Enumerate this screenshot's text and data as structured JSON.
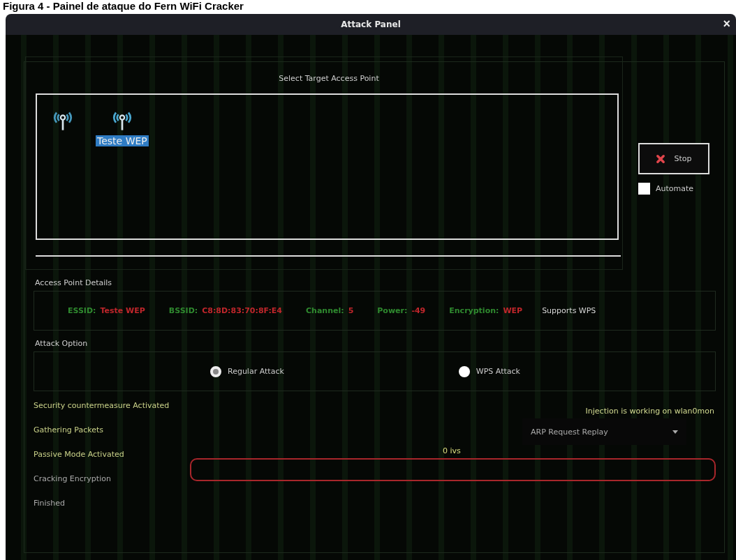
{
  "caption": "Figura 4 - Painel de ataque do Fern WiFi Cracker",
  "window": {
    "title": "Attack Panel",
    "close": "×"
  },
  "target": {
    "heading": "Select Target Access Point",
    "access_points": [
      {
        "selected": false
      },
      {
        "label": "Teste WEP",
        "selected": true
      }
    ]
  },
  "stop_button": {
    "label": "Stop"
  },
  "automate": {
    "label": "Automate",
    "checked": false
  },
  "details": {
    "heading": "Access Point Details",
    "fields": [
      {
        "label": "ESSID:",
        "value": "Teste WEP"
      },
      {
        "label": "BSSID:",
        "value": "C8:8D:83:70:8F:E4"
      },
      {
        "label": "Channel:",
        "value": "5"
      },
      {
        "label": "Power:",
        "value": "-49"
      },
      {
        "label": "Encryption:",
        "value": "WEP"
      }
    ],
    "wps_note": "Supports WPS"
  },
  "attack_option": {
    "heading": "Attack Option",
    "options": [
      {
        "label": "Regular Attack",
        "selected": true
      },
      {
        "label": "WPS  Attack",
        "selected": false
      }
    ]
  },
  "steps": [
    {
      "label": "Security countermeasure Activated",
      "active": true
    },
    {
      "label": "Gathering Packets",
      "active": true
    },
    {
      "label": "Passive Mode Activated",
      "active": true
    },
    {
      "label": "Cracking Encryption",
      "active": false
    },
    {
      "label": "Finished",
      "active": false
    }
  ],
  "injection_status": "Injection is working on wlan0mon",
  "attack_mode": {
    "value": "ARP Request Replay"
  },
  "ivs": "0 ivs",
  "progress": {
    "level": 0
  }
}
